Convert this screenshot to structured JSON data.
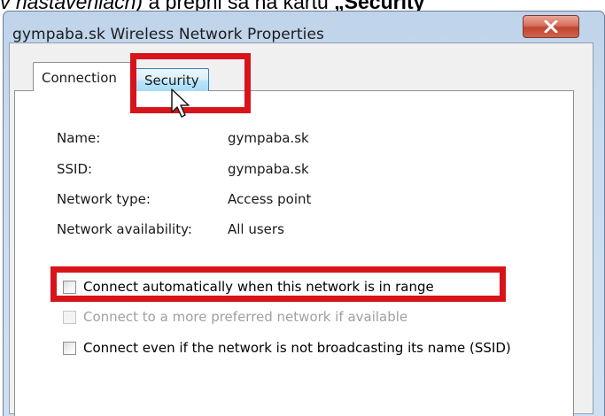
{
  "caption": {
    "part1": "v nastaveniach)",
    "part2": " a prepni sa na kartu ",
    "part3": "„Security"
  },
  "window": {
    "title": "gympaba.sk Wireless Network Properties",
    "close_icon": "close-x-icon"
  },
  "tabs": [
    {
      "label": "Connection",
      "selected": true
    },
    {
      "label": "Security",
      "selected": false,
      "hovered": true
    }
  ],
  "properties": [
    {
      "label": "Name:",
      "value": "gympaba.sk"
    },
    {
      "label": "SSID:",
      "value": "gympaba.sk"
    },
    {
      "label": "Network type:",
      "value": "Access point"
    },
    {
      "label": "Network availability:",
      "value": "All users"
    }
  ],
  "options": [
    {
      "label": "Connect automatically when this network is in range",
      "checked": false,
      "enabled": true
    },
    {
      "label": "Connect to a more preferred network if available",
      "checked": false,
      "enabled": false
    },
    {
      "label": "Connect even if the network is not broadcasting its name (SSID)",
      "checked": false,
      "enabled": true
    }
  ],
  "colors": {
    "highlight": "#d8141b",
    "tab_hover": "#bee6fd",
    "title_bar": "#c9dcef"
  }
}
